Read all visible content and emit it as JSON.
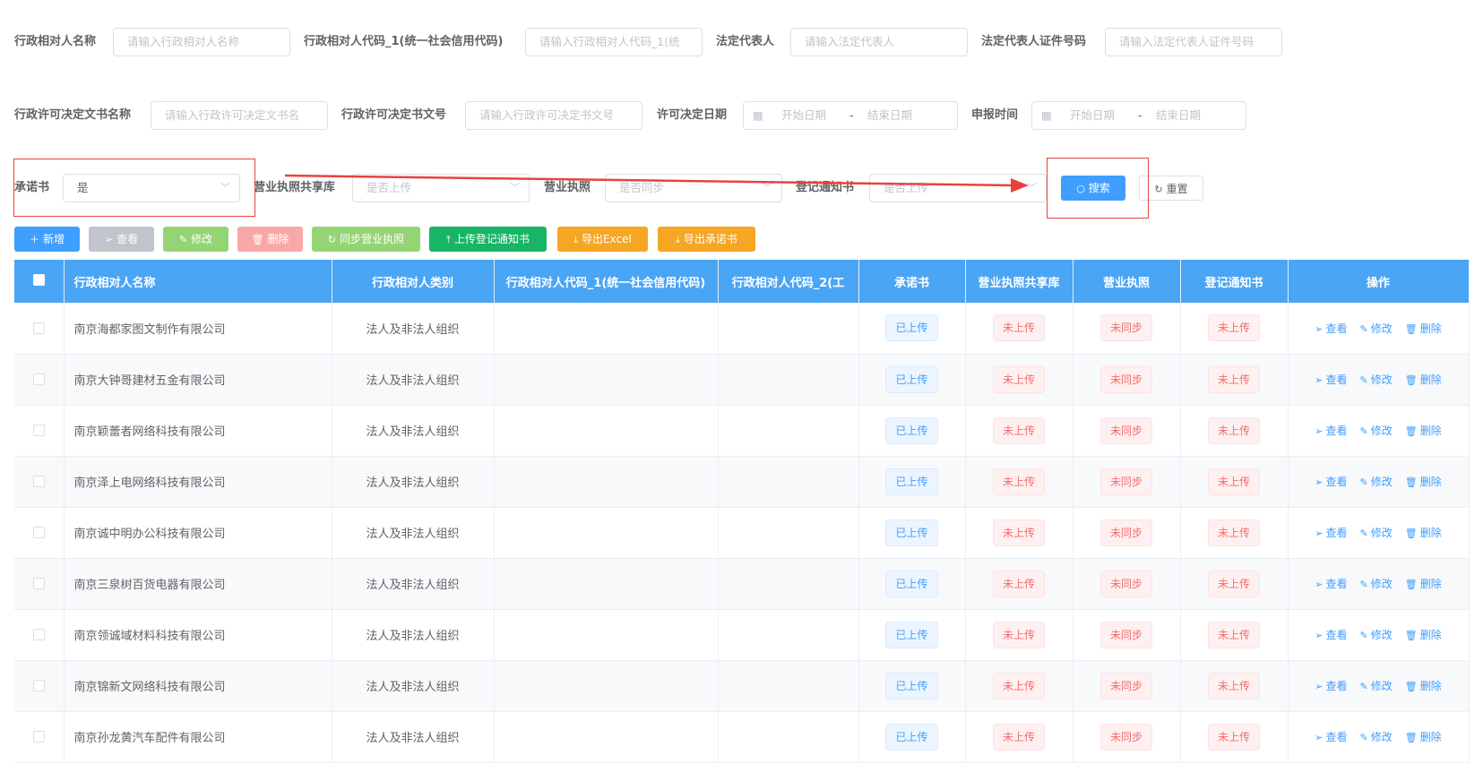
{
  "filters": {
    "row1": [
      {
        "label": "行政相对人名称",
        "placeholder": "请输入行政相对人名称"
      },
      {
        "label": "行政相对人代码_1(统一社会信用代码)",
        "placeholder": "请输入行政相对人代码_1(统"
      },
      {
        "label": "法定代表人",
        "placeholder": "请输入法定代表人"
      },
      {
        "label": "法定代表人证件号码",
        "placeholder": "请输入法定代表人证件号码"
      }
    ],
    "row2": [
      {
        "label": "行政许可决定文书名称",
        "placeholder": "请输入行政许可决定文书名"
      },
      {
        "label": "行政许可决定书文号",
        "placeholder": "请输入行政许可决定书文号"
      },
      {
        "label": "许可决定日期",
        "start": "开始日期",
        "sep": "-",
        "end": "结束日期"
      },
      {
        "label": "申报时间",
        "start": "开始日期",
        "sep": "-",
        "end": "结束日期"
      }
    ],
    "row3": [
      {
        "label": "承诺书",
        "value": "是"
      },
      {
        "label": "营业执照共享库",
        "placeholder": "是否上传"
      },
      {
        "label": "营业执照",
        "placeholder": "是否同步"
      },
      {
        "label": "登记通知书",
        "placeholder": "是否上传"
      }
    ],
    "search_label": "搜索",
    "reset_label": "重置"
  },
  "toolbar": [
    {
      "label": "新增",
      "icon": "plus-icon",
      "color": "#409eff"
    },
    {
      "label": "查看",
      "icon": "send-icon",
      "color": "#c0c4cc"
    },
    {
      "label": "修改",
      "icon": "edit-icon",
      "color": "#95d475"
    },
    {
      "label": "删除",
      "icon": "trash-icon",
      "color": "#f9a8a8"
    },
    {
      "label": "同步营业执照",
      "icon": "refresh-icon",
      "color": "#95d475"
    },
    {
      "label": "上传登记通知书",
      "icon": "upload-icon",
      "color": "#18b566"
    },
    {
      "label": "导出Excel",
      "icon": "download-icon",
      "color": "#f5a623"
    },
    {
      "label": "导出承诺书",
      "icon": "download-icon",
      "color": "#f5a623"
    }
  ],
  "table": {
    "headers": [
      "行政相对人名称",
      "行政相对人类别",
      "行政相对人代码_1(统一社会信用代码)",
      "行政相对人代码_2(工",
      "承诺书",
      "营业执照共享库",
      "营业执照",
      "登记通知书",
      "操作"
    ],
    "rows": [
      {
        "name": "南京海都家图文制作有限公司",
        "type": "法人及非法人组织",
        "code1": "",
        "code2": "",
        "promise": "已上传",
        "share": "未上传",
        "license": "未同步",
        "notice": "未上传"
      },
      {
        "name": "南京大钟哥建材五金有限公司",
        "type": "法人及非法人组织",
        "code1": "",
        "code2": "",
        "promise": "已上传",
        "share": "未上传",
        "license": "未同步",
        "notice": "未上传"
      },
      {
        "name": "南京颖蕾者网络科技有限公司",
        "type": "法人及非法人组织",
        "code1": "",
        "code2": "",
        "promise": "已上传",
        "share": "未上传",
        "license": "未同步",
        "notice": "未上传"
      },
      {
        "name": "南京泽上电网络科技有限公司",
        "type": "法人及非法人组织",
        "code1": "",
        "code2": "",
        "promise": "已上传",
        "share": "未上传",
        "license": "未同步",
        "notice": "未上传"
      },
      {
        "name": "南京诚中明办公科技有限公司",
        "type": "法人及非法人组织",
        "code1": "",
        "code2": "",
        "promise": "已上传",
        "share": "未上传",
        "license": "未同步",
        "notice": "未上传"
      },
      {
        "name": "南京三泉树百货电器有限公司",
        "type": "法人及非法人组织",
        "code1": "",
        "code2": "",
        "promise": "已上传",
        "share": "未上传",
        "license": "未同步",
        "notice": "未上传"
      },
      {
        "name": "南京领诚域材料科技有限公司",
        "type": "法人及非法人组织",
        "code1": "",
        "code2": "",
        "promise": "已上传",
        "share": "未上传",
        "license": "未同步",
        "notice": "未上传"
      },
      {
        "name": "南京锦新文网络科技有限公司",
        "type": "法人及非法人组织",
        "code1": "",
        "code2": "",
        "promise": "已上传",
        "share": "未上传",
        "license": "未同步",
        "notice": "未上传"
      },
      {
        "name": "南京孙龙黄汽车配件有限公司",
        "type": "法人及非法人组织",
        "code1": "",
        "code2": "",
        "promise": "已上传",
        "share": "未上传",
        "license": "未同步",
        "notice": "未上传"
      }
    ],
    "actions": {
      "view": "查看",
      "edit": "修改",
      "delete": "删除"
    }
  }
}
